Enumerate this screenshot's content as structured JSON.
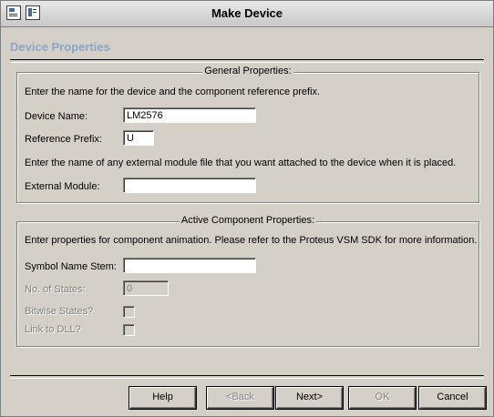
{
  "window": {
    "title": "Make Device"
  },
  "header": {
    "page_title": "Device Properties"
  },
  "general": {
    "legend": "General Properties:",
    "intro": "Enter the name for the device and the component reference prefix.",
    "device_name_label": "Device Name:",
    "device_name_value": "LM2576",
    "reference_prefix_label": "Reference Prefix:",
    "reference_prefix_value": "U",
    "module_intro": "Enter the name of any external module file that you want attached to the device when it is placed.",
    "external_module_label": "External Module:",
    "external_module_value": ""
  },
  "active": {
    "legend": "Active Component Properties:",
    "intro": "Enter properties for component animation. Please refer to the Proteus VSM SDK for more information.",
    "symbol_name_stem_label": "Symbol Name Stem:",
    "symbol_name_stem_value": "",
    "num_states_label": "No. of States:",
    "num_states_value": "0",
    "bitwise_states_label": "Bitwise States?",
    "link_to_dll_label": "Link to DLL?"
  },
  "buttons": {
    "help": "Help",
    "back": "<Back",
    "next": "Next>",
    "ok": "OK",
    "cancel": "Cancel"
  }
}
